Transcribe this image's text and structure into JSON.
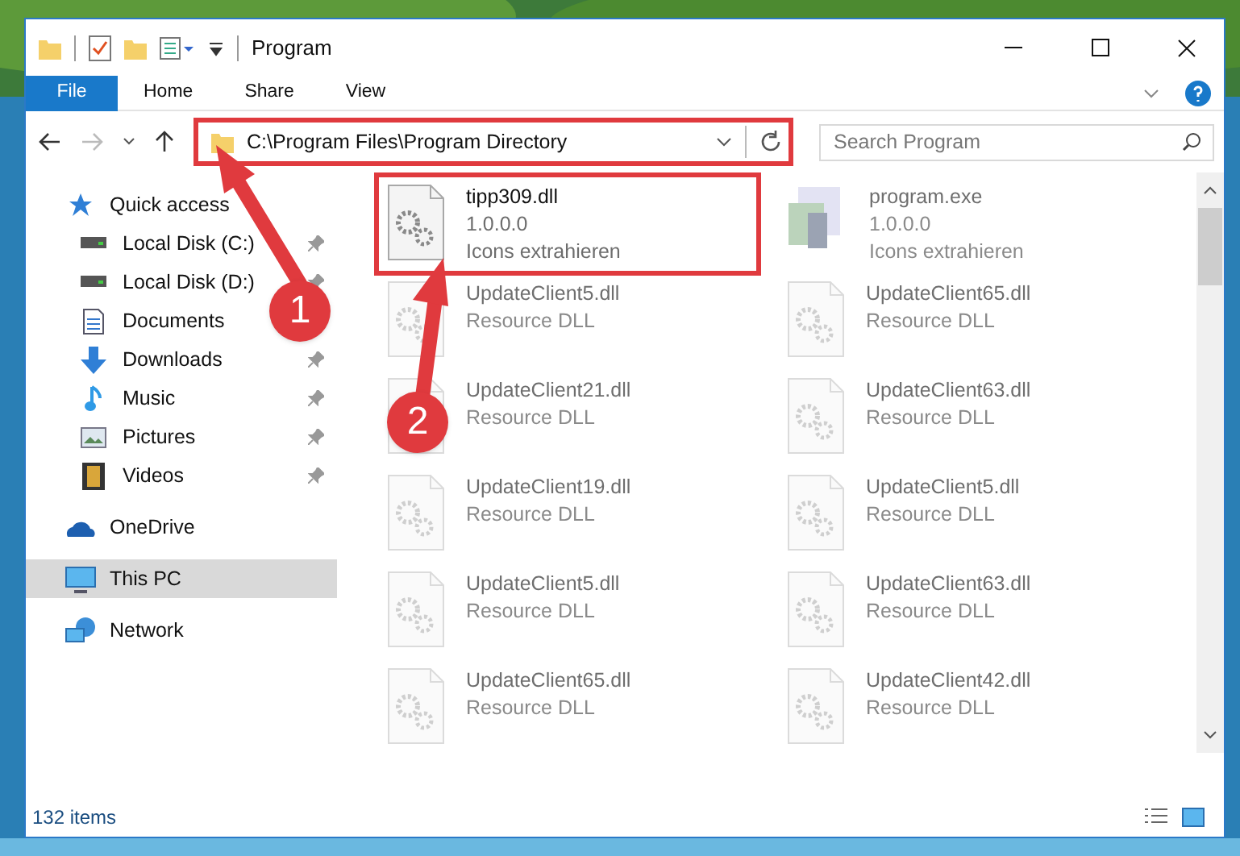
{
  "window": {
    "title": "Program"
  },
  "ribbon_tabs": [
    {
      "label": "File",
      "selected": true
    },
    {
      "label": "Home",
      "selected": false
    },
    {
      "label": "Share",
      "selected": false
    },
    {
      "label": "View",
      "selected": false
    }
  ],
  "address_bar": {
    "path": "C:\\Program Files\\Program Directory",
    "highlighted": true
  },
  "search": {
    "placeholder": "Search Program"
  },
  "sidebar": {
    "items": [
      {
        "label": "Quick access",
        "selected": false,
        "children": [
          {
            "label": "Local Disk (C:)",
            "pinned": true,
            "selected": false
          },
          {
            "label": "Local Disk (D:)",
            "pinned": true,
            "selected": false
          },
          {
            "label": "Documents",
            "selected": false
          },
          {
            "label": "Downloads",
            "pinned": true,
            "selected": false
          },
          {
            "label": "Music",
            "pinned": true,
            "selected": false
          },
          {
            "label": "Pictures",
            "pinned": true,
            "selected": false
          },
          {
            "label": "Videos",
            "pinned": true,
            "selected": false
          }
        ]
      },
      {
        "label": "OneDrive",
        "selected": false
      },
      {
        "label": "This PC",
        "selected": true
      },
      {
        "label": "Network",
        "selected": false
      }
    ]
  },
  "files": [
    {
      "name": "tipp309.dll",
      "line_2": "1.0.0.0",
      "line_3": "Icons extrahieren",
      "kind": "dll",
      "highlighted": true,
      "dimmed": false
    },
    {
      "name": "program.exe",
      "line_2": "1.0.0.0",
      "line_3": "Icons extrahieren",
      "kind": "exe",
      "highlighted": false,
      "dimmed": true
    },
    {
      "name": "UpdateClient5.dll",
      "line_2": "Resource DLL",
      "kind": "dll",
      "highlighted": false,
      "dimmed": true
    },
    {
      "name": "UpdateClient65.dll",
      "line_2": "Resource DLL",
      "kind": "dll",
      "highlighted": false,
      "dimmed": true
    },
    {
      "name": "UpdateClient21.dll",
      "line_2": "Resource DLL",
      "kind": "dll",
      "highlighted": false,
      "dimmed": true
    },
    {
      "name": "UpdateClient63.dll",
      "line_2": "Resource DLL",
      "kind": "dll",
      "highlighted": false,
      "dimmed": true
    },
    {
      "name": "UpdateClient19.dll",
      "line_2": "Resource DLL",
      "kind": "dll",
      "highlighted": false,
      "dimmed": true
    },
    {
      "name": "UpdateClient5.dll",
      "line_2": "Resource DLL",
      "kind": "dll",
      "highlighted": false,
      "dimmed": true
    },
    {
      "name": "UpdateClient5.dll",
      "line_2": "Resource DLL",
      "kind": "dll",
      "highlighted": false,
      "dimmed": true
    },
    {
      "name": "UpdateClient63.dll",
      "line_2": "Resource DLL",
      "kind": "dll",
      "highlighted": false,
      "dimmed": true
    },
    {
      "name": "UpdateClient65.dll",
      "line_2": "Resource DLL",
      "kind": "dll",
      "highlighted": false,
      "dimmed": true
    },
    {
      "name": "UpdateClient42.dll",
      "line_2": "Resource DLL",
      "kind": "dll",
      "highlighted": false,
      "dimmed": true
    }
  ],
  "status_bar": {
    "item_count": "132 items"
  },
  "callouts": [
    {
      "label": "1"
    },
    {
      "label": "2"
    }
  ]
}
